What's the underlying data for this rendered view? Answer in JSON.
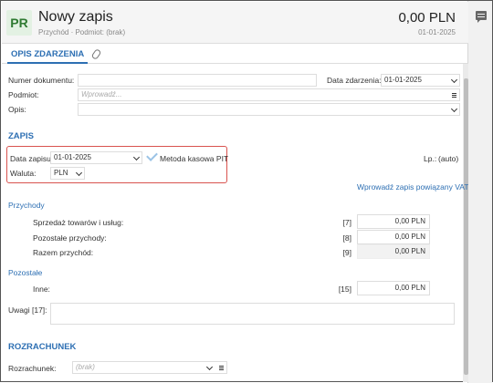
{
  "header": {
    "badge": "PR",
    "title": "Nowy zapis",
    "subtitle": "Przychód · Podmiot: (brak)",
    "amount": "0,00 PLN",
    "date": "01-01-2025"
  },
  "tabs": {
    "opis": "OPIS ZDARZENIA"
  },
  "opis": {
    "numer_label": "Numer dokumentu:",
    "numer_value": "",
    "data_label": "Data zdarzenia:",
    "data_value": "01-01-2025",
    "podmiot_label": "Podmiot:",
    "podmiot_placeholder": "Wprowadź...",
    "opis_label": "Opis:",
    "opis_value": ""
  },
  "zapis": {
    "section": "ZAPIS",
    "data_label": "Data zapisu",
    "data_value": "01-01-2025",
    "metoda_label": "Metoda kasowa PIT",
    "lp_label": "Lp.:",
    "lp_value": "(auto)",
    "waluta_label": "Waluta:",
    "waluta_value": "PLN",
    "powiazany_link": "Wprowadź zapis powiązany VAT"
  },
  "przychody": {
    "section": "Przychody",
    "rows": [
      {
        "label": "Sprzedaż towarów i usług:",
        "code": "[7]",
        "value": "0,00 PLN"
      },
      {
        "label": "Pozostałe przychody:",
        "code": "[8]",
        "value": "0,00 PLN"
      },
      {
        "label": "Razem przychód:",
        "code": "[9]",
        "value": "0,00 PLN"
      }
    ]
  },
  "pozostale": {
    "section": "Pozostałe",
    "inne_label": "Inne:",
    "inne_code": "[15]",
    "inne_value": "0,00 PLN",
    "uwagi_label": "Uwagi [17]:",
    "uwagi_value": ""
  },
  "rozrachunek": {
    "section": "ROZRACHUNEK",
    "label": "Rozrachunek:",
    "placeholder": "(brak)"
  },
  "icons": [
    "comment-icon",
    "paperclip-icon",
    "chevron-down-icon",
    "menu-icon",
    "checkmark-icon"
  ],
  "colors": {
    "accent": "#2d6fb3",
    "badge_bg": "#e3f1e3",
    "badge_fg": "#2f7a32",
    "highlight_border": "#d9534f"
  }
}
